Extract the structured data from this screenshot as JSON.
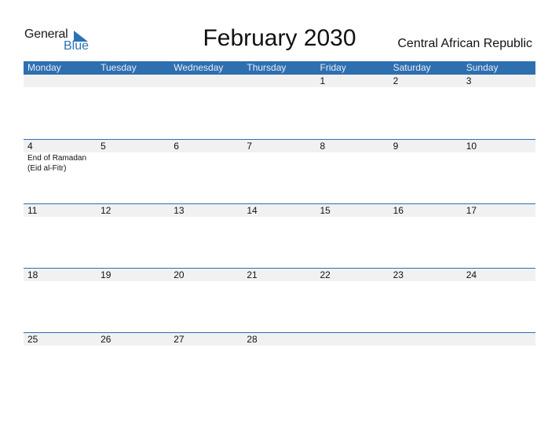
{
  "logo": {
    "general": "General",
    "blue": "Blue",
    "brand_color": "#2b73b6"
  },
  "title": "February 2030",
  "country": "Central African Republic",
  "header_color": "#2e6fb0",
  "weekdays": [
    "Monday",
    "Tuesday",
    "Wednesday",
    "Thursday",
    "Friday",
    "Saturday",
    "Sunday"
  ],
  "weeks": [
    {
      "days": [
        "",
        "",
        "",
        "",
        "1",
        "2",
        "3"
      ],
      "events": [
        "",
        "",
        "",
        "",
        "",
        "",
        ""
      ]
    },
    {
      "days": [
        "4",
        "5",
        "6",
        "7",
        "8",
        "9",
        "10"
      ],
      "events": [
        "End of Ramadan (Eid al-Fitr)",
        "",
        "",
        "",
        "",
        "",
        ""
      ]
    },
    {
      "days": [
        "11",
        "12",
        "13",
        "14",
        "15",
        "16",
        "17"
      ],
      "events": [
        "",
        "",
        "",
        "",
        "",
        "",
        ""
      ]
    },
    {
      "days": [
        "18",
        "19",
        "20",
        "21",
        "22",
        "23",
        "24"
      ],
      "events": [
        "",
        "",
        "",
        "",
        "",
        "",
        ""
      ]
    },
    {
      "days": [
        "25",
        "26",
        "27",
        "28",
        "",
        "",
        ""
      ],
      "events": [
        "",
        "",
        "",
        "",
        "",
        "",
        ""
      ]
    }
  ]
}
